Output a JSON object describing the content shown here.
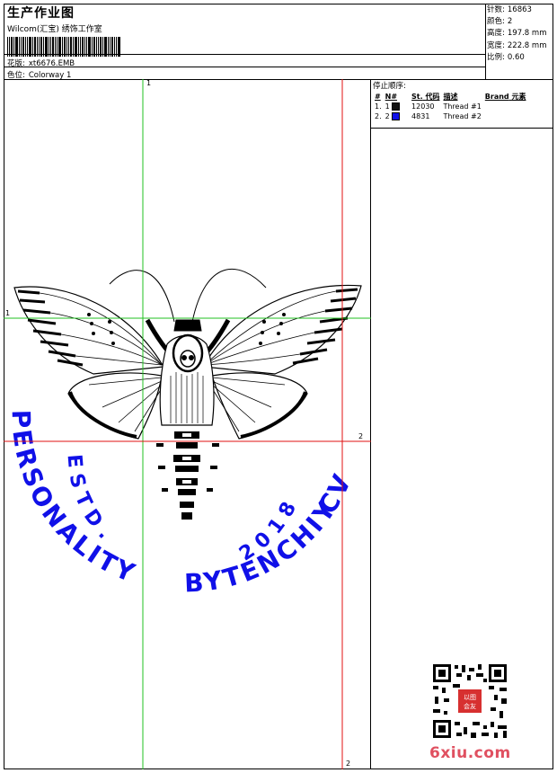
{
  "header": {
    "title": "生产作业图",
    "company": "Wilcom(汇宝) 绣饰工作室",
    "pattern_label": "花版:",
    "pattern_value": "xt6676.EMB",
    "colorway_label": "色位:",
    "colorway_value": "Colorway 1"
  },
  "stats": {
    "stitches_label": "针数:",
    "stitches_value": "16863",
    "colors_label": "颜色:",
    "colors_value": "2",
    "height_label": "高度:",
    "height_value": "197.8 mm",
    "width_label": "宽度:",
    "width_value": "222.8 mm",
    "scale_label": "比例:",
    "scale_value": "0.60"
  },
  "sequence": {
    "heading": "停止顺序:",
    "columns": [
      "#",
      "N#",
      "St.",
      "代码",
      "描述",
      "Brand",
      "元素"
    ],
    "rows": [
      {
        "idx": "1.",
        "n": "1",
        "color": "#111111",
        "stitches": "12030",
        "desc": "Thread #1"
      },
      {
        "idx": "2.",
        "n": "2",
        "color": "#1010e8",
        "stitches": "4831",
        "desc": "Thread #2"
      }
    ]
  },
  "design": {
    "guides": {
      "v1": "1",
      "h1": "1",
      "h2": "2",
      "v2": "2"
    },
    "text_arc_left": "PERSONALITY",
    "text_arc_estd": "ESTD.",
    "text_arc_year": "2018",
    "text_arc_right": "BYTENCHIY",
    "text_arc_cv": "CV",
    "text_color": "#1010e8",
    "guide_green": "#22c022",
    "guide_red": "#e01010"
  },
  "footer": {
    "site": "6xiu.com",
    "qr_seal": "以图会友"
  }
}
